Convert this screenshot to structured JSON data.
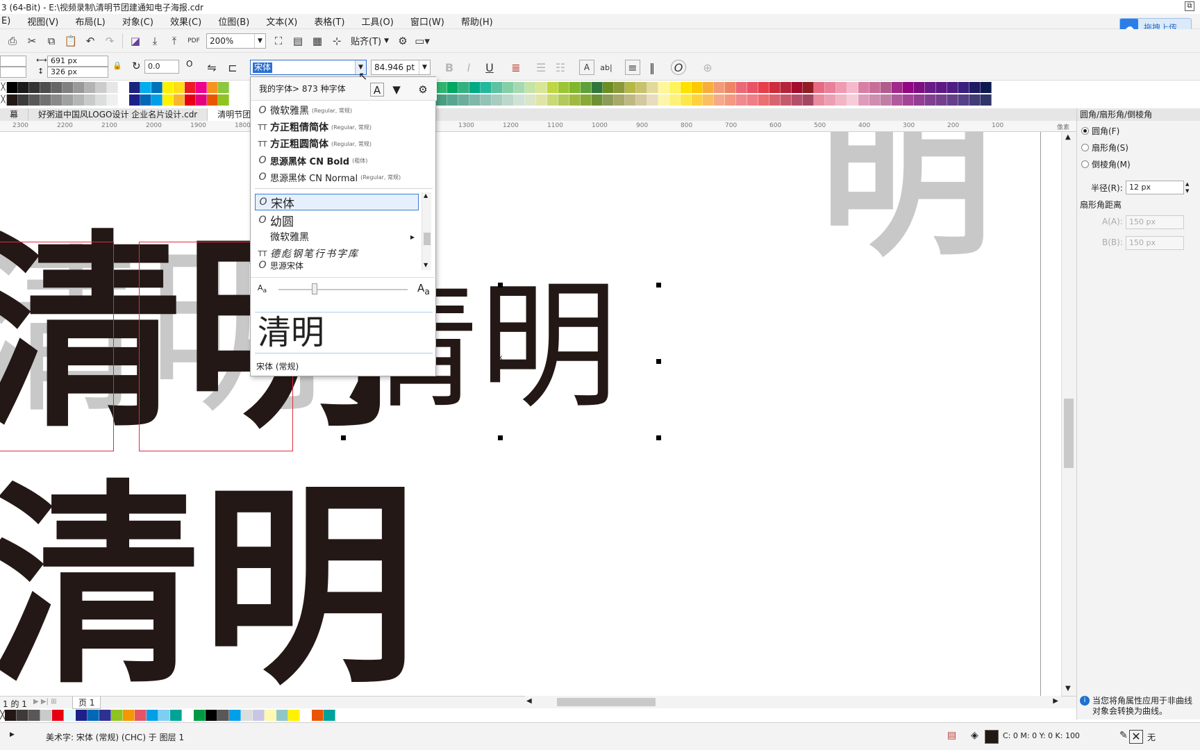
{
  "window": {
    "title": "3 (64-Bit) - E:\\视频录制\\清明节团建通知电子海报.cdr"
  },
  "menu": [
    "E)",
    "视图(V)",
    "布局(L)",
    "对象(C)",
    "效果(C)",
    "位图(B)",
    "文本(X)",
    "表格(T)",
    "工具(O)",
    "窗口(W)",
    "帮助(H)"
  ],
  "upload_button": "拖拽上传",
  "toolbar": {
    "zoom": "200%",
    "snap_label": "贴齐(T)"
  },
  "property_bar": {
    "width": "691 px",
    "height": "326 px",
    "rotation": "0.0",
    "font_name": "宋体",
    "font_size": "84.946 pt",
    "bold": "B",
    "italic": "I",
    "underline": "U"
  },
  "palette_colors_row1": [
    "#000000",
    "#1a1a1a",
    "#333333",
    "#4d4d4d",
    "#666666",
    "#808080",
    "#999999",
    "#b3b3b3",
    "#cccccc",
    "#e6e6e6",
    "#ffffff",
    "#1a237e",
    "#00aeef",
    "#0072bc",
    "#fff200",
    "#ffde17",
    "#ed1c24",
    "#ec008c",
    "#f7941d",
    "#8dc63f"
  ],
  "palette_colors_row2": [
    "#231815",
    "#3b3b3b",
    "#595757",
    "#727171",
    "#898989",
    "#9fa0a0",
    "#b5b5b6",
    "#c9caca",
    "#dcdddd",
    "#efefef",
    "#ffffff",
    "#1d2088",
    "#0068b7",
    "#00a0e9",
    "#fff100",
    "#f8b62d",
    "#e60012",
    "#e4007f",
    "#ea5504",
    "#8fc31f"
  ],
  "palette_colors_right_row1": [
    "#2eb66f",
    "#00a95f",
    "#33b27f",
    "#00ab84",
    "#24b89d",
    "#5dc2a0",
    "#85cfa4",
    "#a6d9b1",
    "#c4e3a4",
    "#d8e696",
    "#bed742",
    "#9bc534",
    "#80b72d",
    "#5da13c",
    "#31773c",
    "#6b8e23",
    "#8a9a3a",
    "#b5b846",
    "#c9c26c",
    "#e3d99a",
    "#fff799",
    "#fff45c",
    "#ffe100",
    "#fcc800",
    "#f6ad3c",
    "#f29b76",
    "#ee8466",
    "#eb6877",
    "#e95464",
    "#e83f4b",
    "#ce2b3c",
    "#b3243b",
    "#a40b2d",
    "#8f1d22",
    "#e66a83",
    "#e97f9b",
    "#ee9bb3",
    "#f4b9cc",
    "#d77fa4",
    "#c66e99",
    "#b05d8b",
    "#a3288b",
    "#920783",
    "#7d0f80",
    "#6a1b87",
    "#5f1985",
    "#4e1d84",
    "#3a1f7d",
    "#1e1b63",
    "#0d1a4e"
  ],
  "palette_colors_right_row2": [
    "#4a9e83",
    "#5aa591",
    "#6dad9c",
    "#80b7a8",
    "#94c2b4",
    "#a8ccbf",
    "#bcd7cb",
    "#d0e2d7",
    "#dbe5c8",
    "#e0e4a6",
    "#c8d977",
    "#b2c95c",
    "#a0b943",
    "#88a83a",
    "#6e9135",
    "#8c9b56",
    "#a7a869",
    "#bfb883",
    "#d3c99e",
    "#e7dcbd",
    "#fdf6aa",
    "#fdf17a",
    "#fee74a",
    "#fdd23c",
    "#f9bf62",
    "#f7a98b",
    "#f39982",
    "#f08a8f",
    "#ee7f86",
    "#ec6f72",
    "#d8646f",
    "#c45a6e",
    "#b4506b",
    "#a24862",
    "#e98ca0",
    "#ec9fb2",
    "#f1b6c6",
    "#f6ccd9",
    "#de9cbb",
    "#cf8db0",
    "#bf7fa6",
    "#b05a9e",
    "#a24597",
    "#913f92",
    "#80408f",
    "#74408e",
    "#663f8b",
    "#553f87",
    "#413b76",
    "#2f3566"
  ],
  "tabs": [
    "幕",
    "好粥道中国风LOGO设计 企业名片设计.cdr",
    "清明节团建"
  ],
  "ruler_ticks": [
    "2300",
    "2200",
    "2100",
    "2000",
    "1900",
    "1800",
    "1300",
    "1200",
    "1100",
    "1000",
    "900",
    "800",
    "700",
    "600",
    "500",
    "400",
    "300",
    "200",
    "100",
    "像素"
  ],
  "canvas_text": {
    "left_large": "清明",
    "bottom_large": "清明",
    "selected_text": "清明",
    "top_right": "明"
  },
  "font_dropdown": {
    "header": "我的字体> 873 种字体",
    "recent": [
      {
        "name": "微软雅黑",
        "meta": "(Regular, 常规)",
        "type": "O",
        "bold": false
      },
      {
        "name": "方正粗倩简体",
        "meta": "(Regular, 常规)",
        "type": "TT",
        "bold": true
      },
      {
        "name": "方正粗圆简体",
        "meta": "(Regular, 常规)",
        "type": "TT",
        "bold": true
      },
      {
        "name": "思源黑体 CN Bold",
        "meta": "(粗体)",
        "type": "O",
        "bold": true
      },
      {
        "name": "思源黑体 CN Normal",
        "meta": "(Regular, 常规)",
        "type": "O",
        "bold": false
      }
    ],
    "list": [
      {
        "name": "宋体",
        "type": "O",
        "selected": true
      },
      {
        "name": "幼圆",
        "type": "O",
        "selected": false
      },
      {
        "name": "微软雅黑",
        "type": "",
        "selected": false
      },
      {
        "name": "德彪钢笔行书字库",
        "type": "TT",
        "selected": false
      },
      {
        "name": "思源宋体",
        "type": "O",
        "selected": false
      }
    ],
    "preview": "清明",
    "footer": "宋体 (常规)"
  },
  "docker": {
    "title": "圆角/扇形角/倒棱角",
    "options": [
      "圆角(F)",
      "扇形角(S)",
      "倒棱角(M)"
    ],
    "radius_label": "半径(R):",
    "radius_value": "12 px",
    "scallop_label": "扇形角距离",
    "a_label": "A(A):",
    "a_value": "150 px",
    "b_label": "B(B):",
    "b_value": "150 px",
    "info": "当您将角属性应用于非曲线对象会转换为曲线。"
  },
  "page_nav": {
    "count": "1 的 1",
    "page": "页 1"
  },
  "doc_palette": [
    "#231815",
    "#3e3a39",
    "#595757",
    "#c9caca",
    "#e60012",
    "#dff5ff",
    "#1d2088",
    "#0068b7",
    "#2e3192",
    "#8fc31f",
    "#f39800",
    "#e95464",
    "#009fe8",
    "#7ecef4",
    "#00a497",
    "#ffffff",
    "#009944",
    "#000000",
    "#595757",
    "#00a0e9",
    "#dcdddd",
    "#c9c6e5",
    "#fff9b1",
    "#8fc7c6",
    "#fff100",
    "#ffffff",
    "#ea5504",
    "#00a29a"
  ],
  "status": {
    "object_info": "美术字: 宋体 (常规) (CHC) 于 图层 1",
    "fill": "C: 0 M: 0 Y: 0 K: 100",
    "outline": "无"
  }
}
